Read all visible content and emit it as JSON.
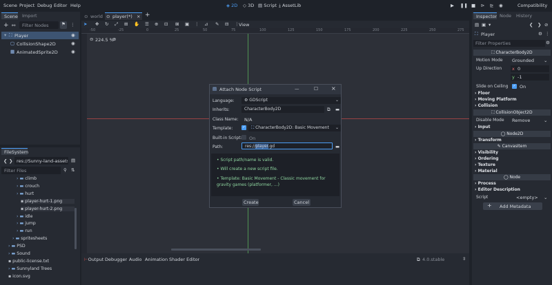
{
  "menubar": {
    "items": [
      "Scene",
      "Project",
      "Debug",
      "Editor",
      "Help"
    ],
    "workspaces": [
      "2D",
      "3D",
      "Script",
      "AssetLib"
    ],
    "renderer": "Compatibility"
  },
  "scene_dock": {
    "tabs": [
      "Scene",
      "Import"
    ],
    "filter_placeholder": "Filter Nodes",
    "nodes": [
      {
        "label": "Player",
        "icon": "character-body-icon"
      },
      {
        "label": "CollisionShape2D",
        "icon": "collision-shape-icon"
      },
      {
        "label": "AnimatedSprite2D",
        "icon": "animated-sprite-icon"
      }
    ]
  },
  "filesystem": {
    "title": "FileSystem",
    "path": "res://Sunny-land-assets-file",
    "filter_placeholder": "Filter Files",
    "items": [
      {
        "label": "climb",
        "kind": "folder",
        "indent": 3
      },
      {
        "label": "crouch",
        "kind": "folder",
        "indent": 3
      },
      {
        "label": "hurt",
        "kind": "folder",
        "indent": 3
      },
      {
        "label": "player-hurt-1.png",
        "kind": "file",
        "indent": 4
      },
      {
        "label": "player-hurt-2.png",
        "kind": "file",
        "indent": 4
      },
      {
        "label": "idle",
        "kind": "folder",
        "indent": 3
      },
      {
        "label": "jump",
        "kind": "folder",
        "indent": 3
      },
      {
        "label": "run",
        "kind": "folder",
        "indent": 3
      },
      {
        "label": "spritesheets",
        "kind": "folder",
        "indent": 2
      },
      {
        "label": "PSD",
        "kind": "folder",
        "indent": 1
      },
      {
        "label": "Sound",
        "kind": "folder",
        "indent": 1
      },
      {
        "label": "public-license.txt",
        "kind": "file",
        "indent": 1
      },
      {
        "label": "Sunnyland Trees",
        "kind": "folder",
        "indent": 1
      },
      {
        "label": "icon.svg",
        "kind": "file",
        "indent": 1
      }
    ]
  },
  "editor_tabs": [
    "world",
    "player(*)"
  ],
  "viewport": {
    "zoom": "224.5 %",
    "view_label": "View",
    "ruler_ticks": [
      "-50",
      "-25",
      "0",
      "25",
      "50",
      "75",
      "100",
      "125",
      "150",
      "175",
      "200",
      "225",
      "250",
      "275"
    ]
  },
  "bottom_panel": {
    "tabs": [
      "Output",
      "Debugger",
      "Audio",
      "Animation",
      "Shader Editor"
    ],
    "version": "4.0.stable"
  },
  "dialog": {
    "title": "Attach Node Script",
    "language_label": "Language:",
    "language_value": "GDScript",
    "inherits_label": "Inherits:",
    "inherits_value": "CharacterBody2D",
    "class_name_label": "Class Name:",
    "class_name_value": "N/A",
    "template_label": "Template:",
    "template_value": "CharacterBody2D: Basic Movement",
    "builtin_label": "Built-in Script:",
    "builtin_value": "On",
    "path_label": "Path:",
    "path_prefix": "res://",
    "path_selected": "player",
    "path_suffix": ".gd",
    "messages": [
      "Script path/name is valid.",
      "Will create a new script file.",
      "Template: Basic Movement - Classic movement for gravity games (platformer, ...)"
    ],
    "create_label": "Create",
    "cancel_label": "Cancel"
  },
  "inspector": {
    "tabs": [
      "Inspector",
      "Node",
      "History"
    ],
    "object_name": "Player",
    "filter_placeholder": "Filter Properties",
    "class_header": "CharacterBody2D",
    "motion_mode_label": "Motion Mode",
    "motion_mode_value": "Grounded",
    "up_direction_label": "Up Direction",
    "up_x_label": "x",
    "up_x_value": "0",
    "up_y_label": "y",
    "up_y_value": "-1",
    "slide_label": "Slide on Ceiling",
    "slide_value": "On",
    "floor_label": "Floor",
    "moving_platform_label": "Moving Platform",
    "collision_label": "Collision",
    "collision_object_header": "CollisionObject2D",
    "disable_mode_label": "Disable Mode",
    "disable_mode_value": "Remove",
    "input_label": "Input",
    "node2d_header": "Node2D",
    "transform_label": "Transform",
    "canvasitem_header": "CanvasItem",
    "visibility_label": "Visibility",
    "ordering_label": "Ordering",
    "texture_label": "Texture",
    "material_label": "Material",
    "node_header": "Node",
    "process_label": "Process",
    "editor_desc_label": "Editor Description",
    "script_label": "Script",
    "script_value": "<empty>",
    "add_metadata_label": "Add Metadata"
  },
  "colors": {
    "accent": "#4c9ef5",
    "valid_text": "#8fd6a0",
    "axis_red": "#c84a4a",
    "axis_green": "#5fbf5f"
  }
}
